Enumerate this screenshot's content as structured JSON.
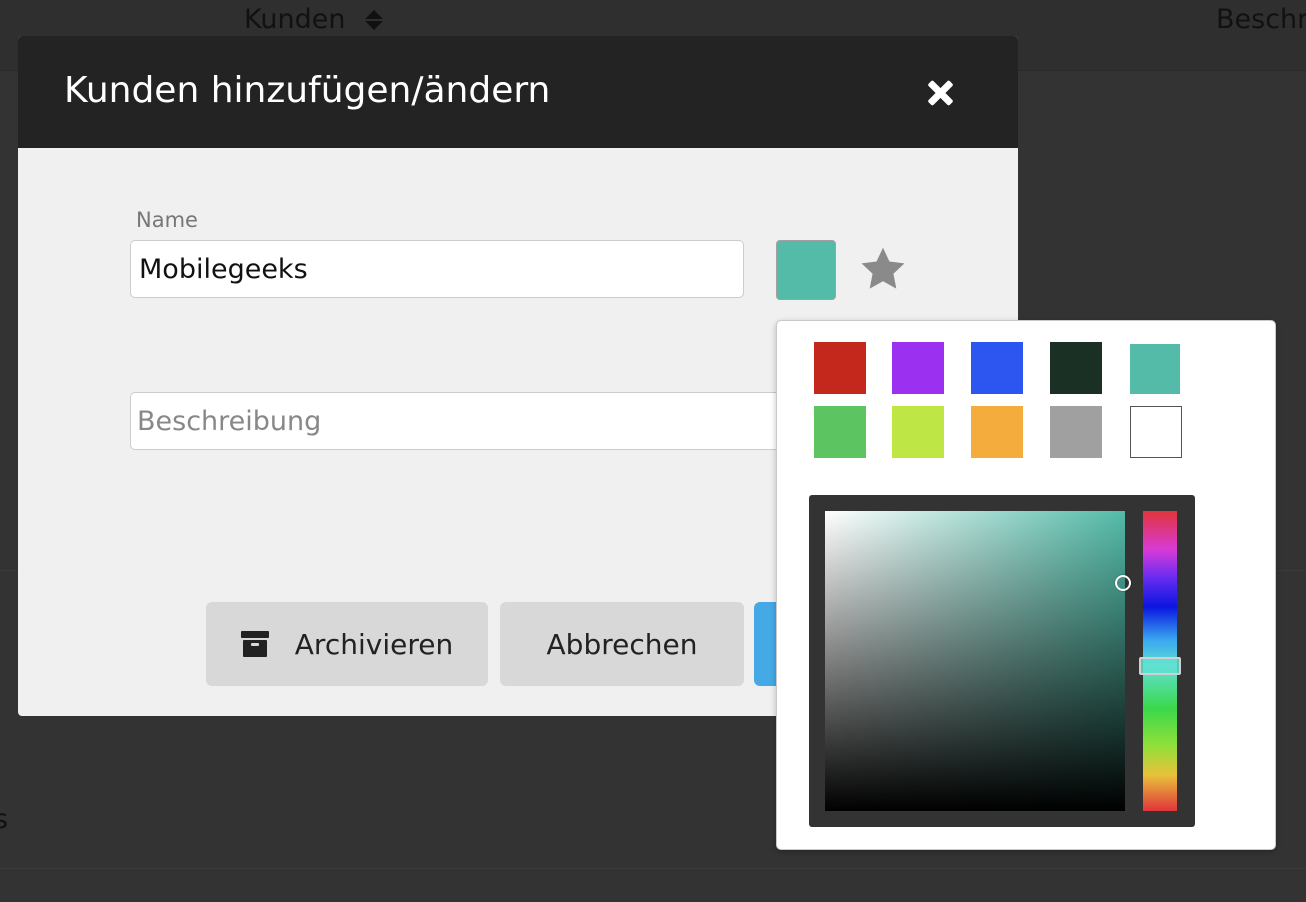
{
  "background": {
    "columns": [
      {
        "label": "Kunden",
        "sort_icon": "sort-icon"
      },
      {
        "label": "Beschr"
      }
    ],
    "row_fragment": "s"
  },
  "modal": {
    "title": "Kunden hinzufügen/ändern",
    "close_icon": "close-icon",
    "name": {
      "label": "Name",
      "value": "Mobilegeeks"
    },
    "selected_color": "#53bba8",
    "favorite_icon": "star-icon",
    "description": {
      "placeholder": "Beschreibung",
      "value": ""
    },
    "buttons": {
      "archive": {
        "label": "Archivieren",
        "icon": "archive-icon"
      },
      "cancel": {
        "label": "Abbrechen"
      },
      "save_color": "#45a9e6"
    }
  },
  "color_picker": {
    "swatches": [
      {
        "name": "red",
        "color": "#c4281c"
      },
      {
        "name": "purple",
        "color": "#9b30f0"
      },
      {
        "name": "blue",
        "color": "#2d55ef"
      },
      {
        "name": "dark-green",
        "color": "#1b3025"
      },
      {
        "name": "teal",
        "color": "#53bba8"
      },
      {
        "name": "green",
        "color": "#5cc461"
      },
      {
        "name": "lime",
        "color": "#bee645"
      },
      {
        "name": "orange",
        "color": "#f4ac3d"
      },
      {
        "name": "gray",
        "color": "#a0a0a0"
      },
      {
        "name": "white",
        "color": "#ffffff"
      }
    ],
    "current_hue_color": "#53bba8"
  }
}
